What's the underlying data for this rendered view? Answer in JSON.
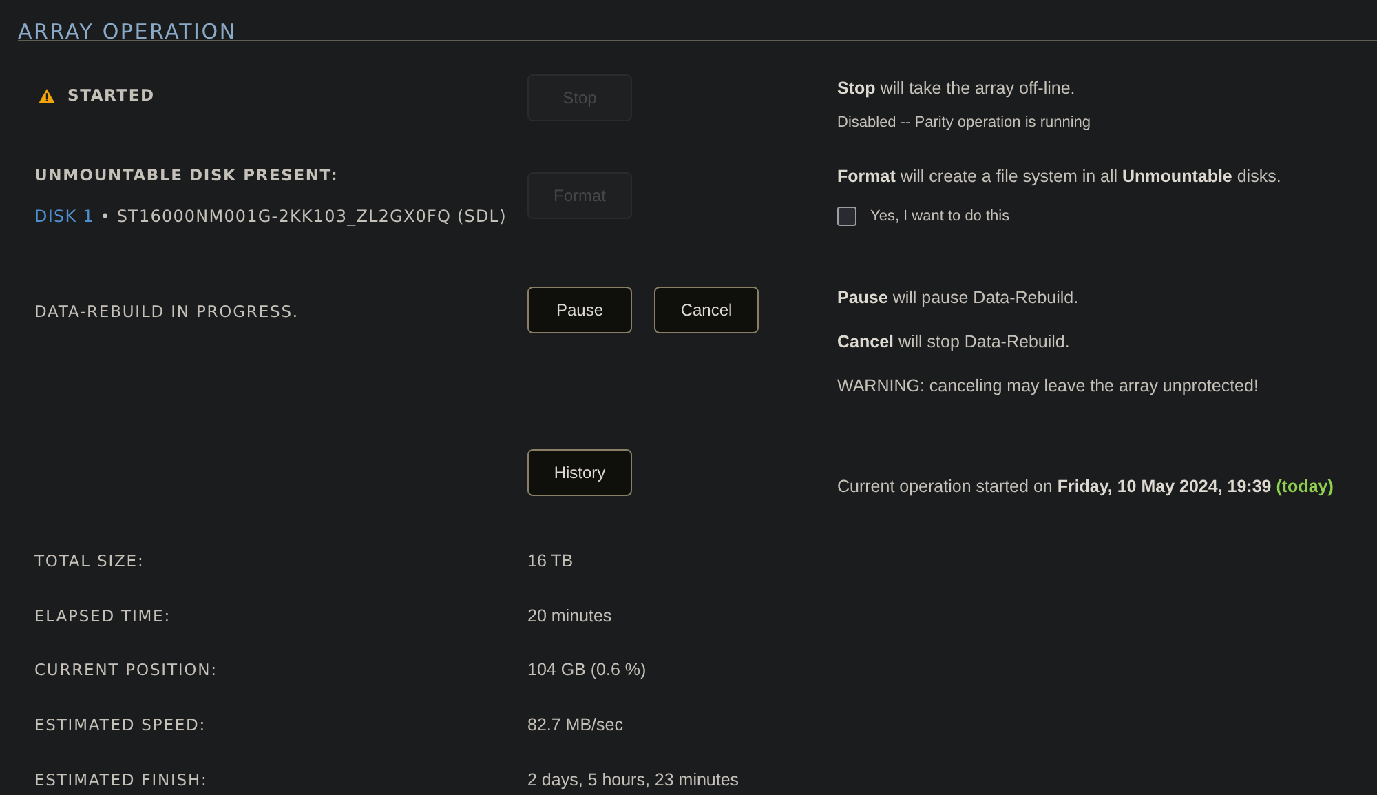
{
  "title": "ARRAY OPERATION",
  "status": {
    "kind": "warning",
    "label": "STARTED"
  },
  "unmountable": {
    "heading": "UNMOUNTABLE DISK PRESENT:",
    "disk_link": "DISK 1",
    "disk_id": "• ST16000NM001G-2KK103_ZL2GX0FQ (SDL)"
  },
  "rebuild": {
    "label": "DATA-REBUILD IN PROGRESS."
  },
  "buttons": {
    "stop": {
      "label": "Stop",
      "disabled": true
    },
    "format": {
      "label": "Format",
      "disabled": true
    },
    "pause": {
      "label": "Pause",
      "disabled": false
    },
    "cancel": {
      "label": "Cancel",
      "disabled": false
    },
    "history": {
      "label": "History",
      "disabled": false
    }
  },
  "help": {
    "stop": "**Stop** will take the array off-line.",
    "stop_note": "Disabled -- Parity operation is running",
    "format": "**Format** will create a file system in all **Unmountable** disks.",
    "confirm": {
      "label": "Yes, I want to do this",
      "checked": false
    },
    "pause": "**Pause** will pause Data-Rebuild.",
    "cancel": "**Cancel** will stop Data-Rebuild.",
    "warning": "WARNING: canceling may leave the array unprotected!",
    "started": "Current operation started on **Friday, 10 May 2024, 19:39**",
    "today": "(today)"
  },
  "stats": [
    {
      "label": "TOTAL SIZE:",
      "value": "16 TB"
    },
    {
      "label": "ELAPSED TIME:",
      "value": "20 minutes"
    },
    {
      "label": "CURRENT POSITION:",
      "value": "104 GB (0.6 %)"
    },
    {
      "label": "ESTIMATED SPEED:",
      "value": "82.7 MB/sec"
    },
    {
      "label": "ESTIMATED FINISH:",
      "value": "2 days, 5 hours, 23 minutes"
    }
  ]
}
